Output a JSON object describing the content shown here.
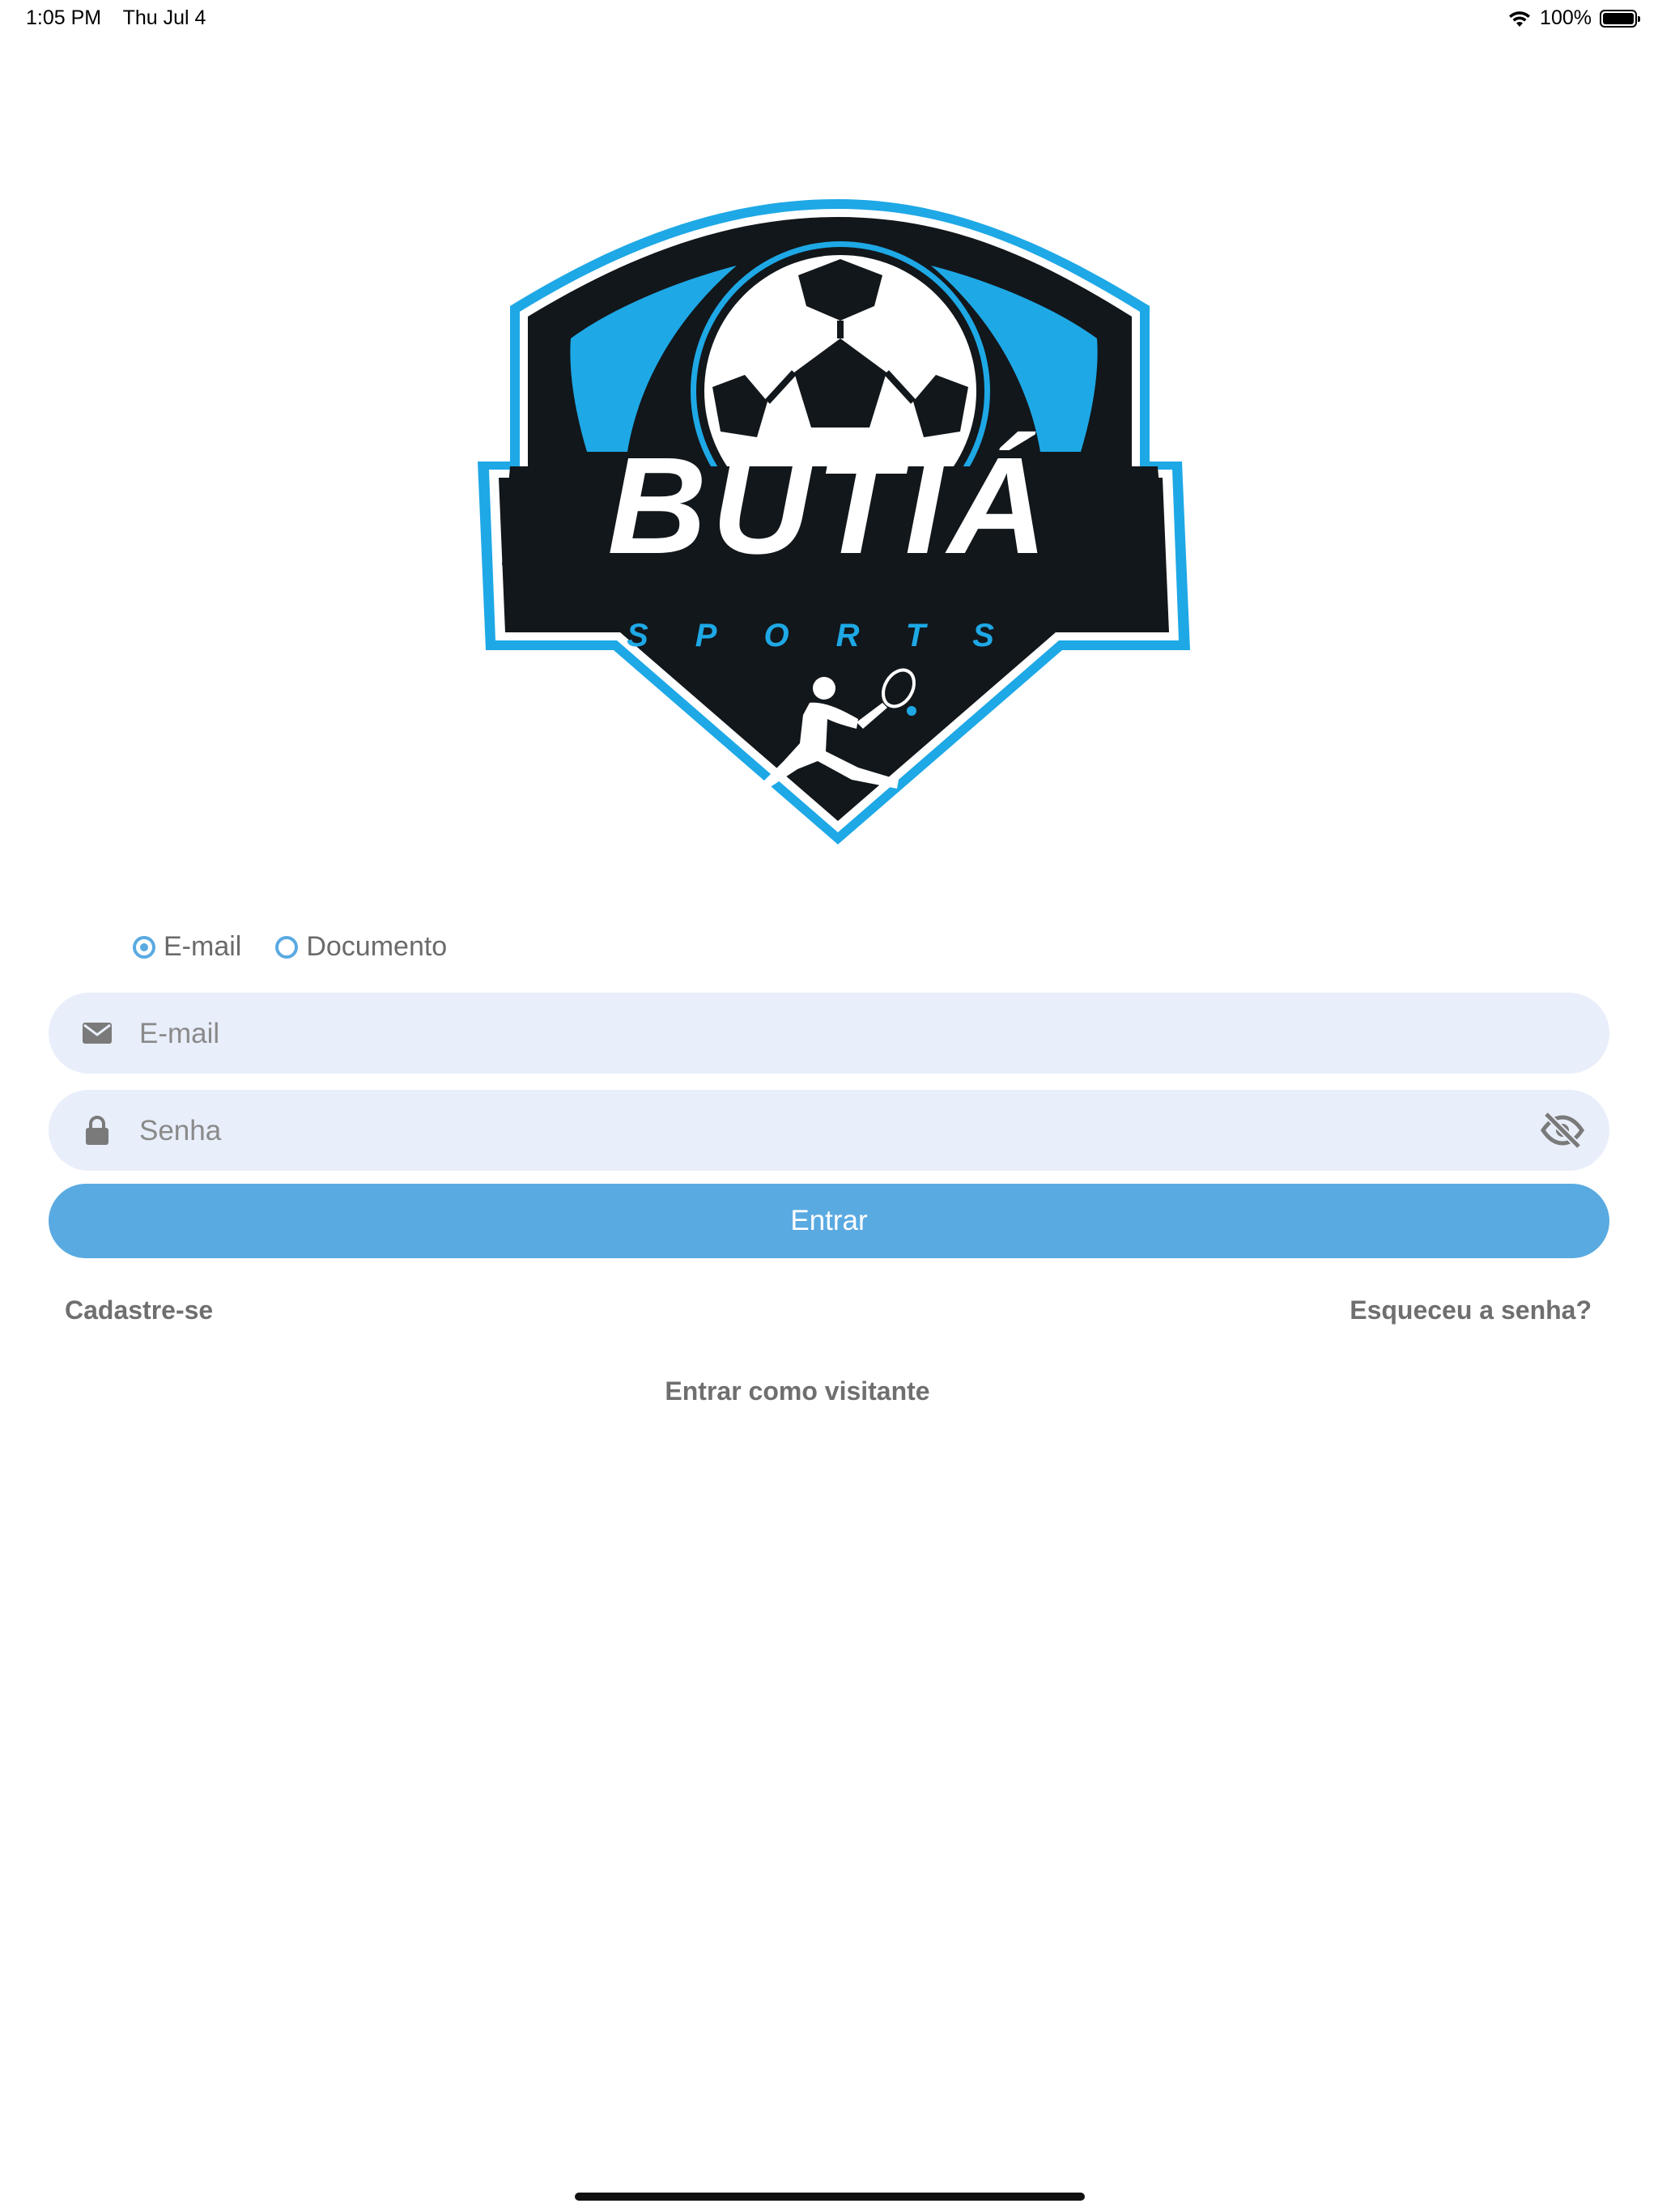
{
  "status_bar": {
    "time": "1:05 PM",
    "date": "Thu Jul 4",
    "battery_text": "100%",
    "battery_level": 1.0
  },
  "logo": {
    "brand": "BUTIÁ",
    "subtitle": "SPORTS",
    "colors": {
      "dark": "#12171b",
      "accent": "#1ea8e6"
    }
  },
  "login_method": {
    "options": [
      "E-mail",
      "Documento"
    ],
    "selected": "E-mail"
  },
  "email_field": {
    "placeholder": "E-mail",
    "value": "",
    "icon": "envelope-icon"
  },
  "password_field": {
    "placeholder": "Senha",
    "value": "",
    "icon": "lock-icon",
    "toggle_icon": "eye-slash-icon"
  },
  "buttons": {
    "enter": "Entrar"
  },
  "links": {
    "signup": "Cadastre-se",
    "forgot": "Esqueceu a senha?",
    "guest": "Entrar como visitante"
  },
  "colors": {
    "primary": "#5aaae2",
    "field_bg": "#e8eefa",
    "text_muted": "#6f6f6f"
  }
}
